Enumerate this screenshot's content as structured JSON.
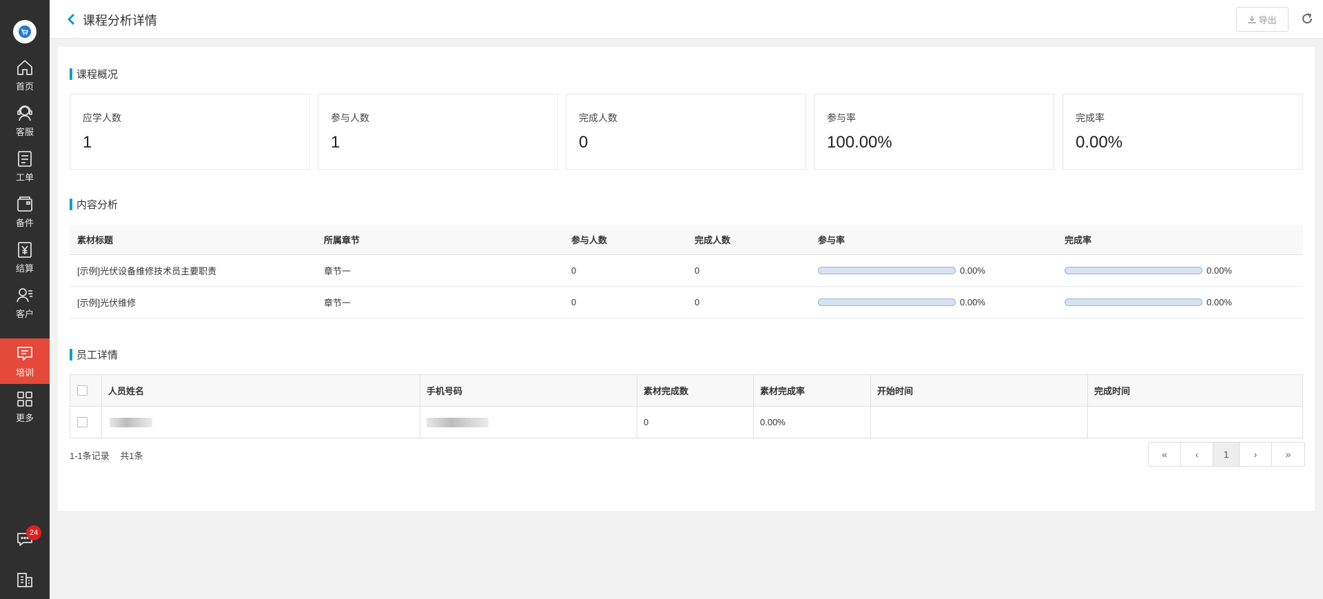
{
  "header": {
    "title": "课程分析详情",
    "export_label": "导出"
  },
  "sidebar": {
    "items": [
      {
        "label": "首页",
        "icon": "home-icon"
      },
      {
        "label": "客服",
        "icon": "headset-icon"
      },
      {
        "label": "工单",
        "icon": "clipboard-icon"
      },
      {
        "label": "备件",
        "icon": "box-icon"
      },
      {
        "label": "结算",
        "icon": "yuan-icon"
      },
      {
        "label": "客户",
        "icon": "contacts-icon"
      },
      {
        "label": "培训",
        "icon": "training-icon"
      },
      {
        "label": "更多",
        "icon": "grid-icon"
      }
    ],
    "active": "培训",
    "message_badge": "24"
  },
  "overview": {
    "title": "课程概况",
    "cards": [
      {
        "label": "应学人数",
        "value": "1"
      },
      {
        "label": "参与人数",
        "value": "1"
      },
      {
        "label": "完成人数",
        "value": "0"
      },
      {
        "label": "参与率",
        "value": "100.00%"
      },
      {
        "label": "完成率",
        "value": "0.00%"
      }
    ]
  },
  "content_analysis": {
    "title": "内容分析",
    "columns": [
      "素材标题",
      "所属章节",
      "参与人数",
      "完成人数",
      "参与率",
      "完成率"
    ],
    "rows": [
      {
        "title": "[示例]光伏设备维修技术员主要职责",
        "chapter": "章节一",
        "participants": "0",
        "completed": "0",
        "participation_rate": "0.00%",
        "participation_value": 0,
        "completion_rate": "0.00%",
        "completion_value": 0
      },
      {
        "title": "[示例]光伏维修",
        "chapter": "章节一",
        "participants": "0",
        "completed": "0",
        "participation_rate": "0.00%",
        "participation_value": 0,
        "completion_rate": "0.00%",
        "completion_value": 0
      }
    ]
  },
  "employees": {
    "title": "员工详情",
    "columns": [
      "人员姓名",
      "手机号码",
      "素材完成数",
      "素材完成率",
      "开始时间",
      "完成时间"
    ],
    "rows": [
      {
        "name": "",
        "phone": "",
        "completed_count": "0",
        "completion_rate": "0.00%",
        "start_time": "",
        "end_time": ""
      }
    ]
  },
  "pagination": {
    "range_text": "1-1条记录",
    "total_text": "共1条",
    "current_page": "1",
    "first": "«",
    "prev": "‹",
    "next": "›",
    "last": "»"
  },
  "colors": {
    "accent": "#0fa0c8",
    "active_nav": "#e5493a",
    "sidebar": "#2f2f2f"
  }
}
